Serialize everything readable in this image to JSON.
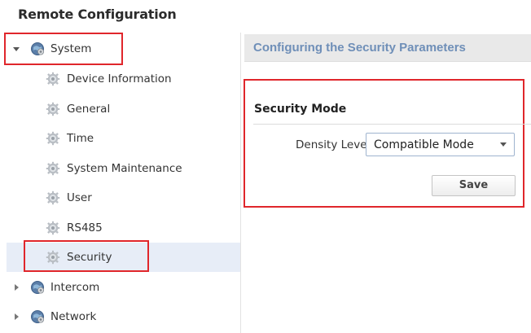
{
  "page": {
    "title": "Remote Configuration"
  },
  "tree": {
    "system": {
      "label": "System"
    },
    "children": [
      {
        "label": "Device Information"
      },
      {
        "label": "General"
      },
      {
        "label": "Time"
      },
      {
        "label": "System Maintenance"
      },
      {
        "label": "User"
      },
      {
        "label": "RS485"
      },
      {
        "label": "Security"
      }
    ],
    "intercom": {
      "label": "Intercom"
    },
    "network": {
      "label": "Network"
    }
  },
  "panel": {
    "header": "Configuring the Security Parameters",
    "section_title": "Security Mode",
    "density_label": "Density Level",
    "density_value": "Compatible Mode",
    "save_label": "Save"
  },
  "colors": {
    "highlight_box": "#e0262b",
    "selected_bg": "#e7edf7",
    "header_text": "#6f8fb8"
  }
}
